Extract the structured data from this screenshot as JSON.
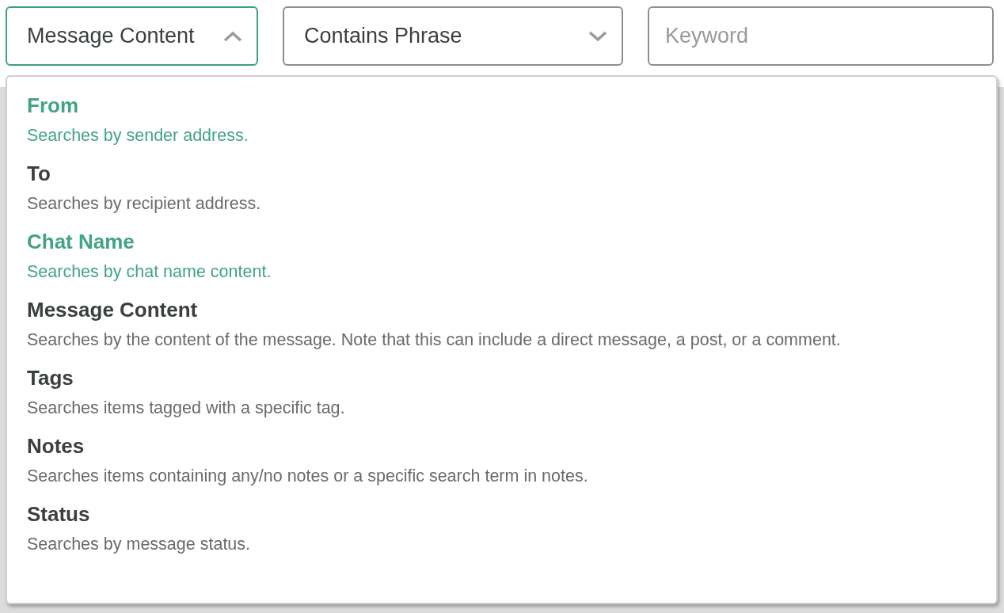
{
  "filters": [
    {
      "kind": "select",
      "value": "Message Content",
      "expanded": true
    },
    {
      "kind": "select",
      "value": "Contains Phrase",
      "expanded": false
    },
    {
      "kind": "input",
      "placeholder": "Keyword"
    }
  ],
  "dropdown": {
    "options": [
      {
        "title": "From",
        "description": "Searches by sender address.",
        "highlighted": true
      },
      {
        "title": "To",
        "description": "Searches by recipient address.",
        "highlighted": false
      },
      {
        "title": "Chat Name",
        "description": "Searches by chat name content.",
        "highlighted": true
      },
      {
        "title": "Message Content",
        "description": "Searches by the content of the message. Note that this can include a direct message, a post, or a comment.",
        "highlighted": false
      },
      {
        "title": "Tags",
        "description": "Searches items tagged with a specific tag.",
        "highlighted": false
      },
      {
        "title": "Notes",
        "description": "Searches items containing any/no notes or a specific search term in notes.",
        "highlighted": false
      },
      {
        "title": "Status",
        "description": "Searches by message status.",
        "highlighted": false
      }
    ]
  }
}
